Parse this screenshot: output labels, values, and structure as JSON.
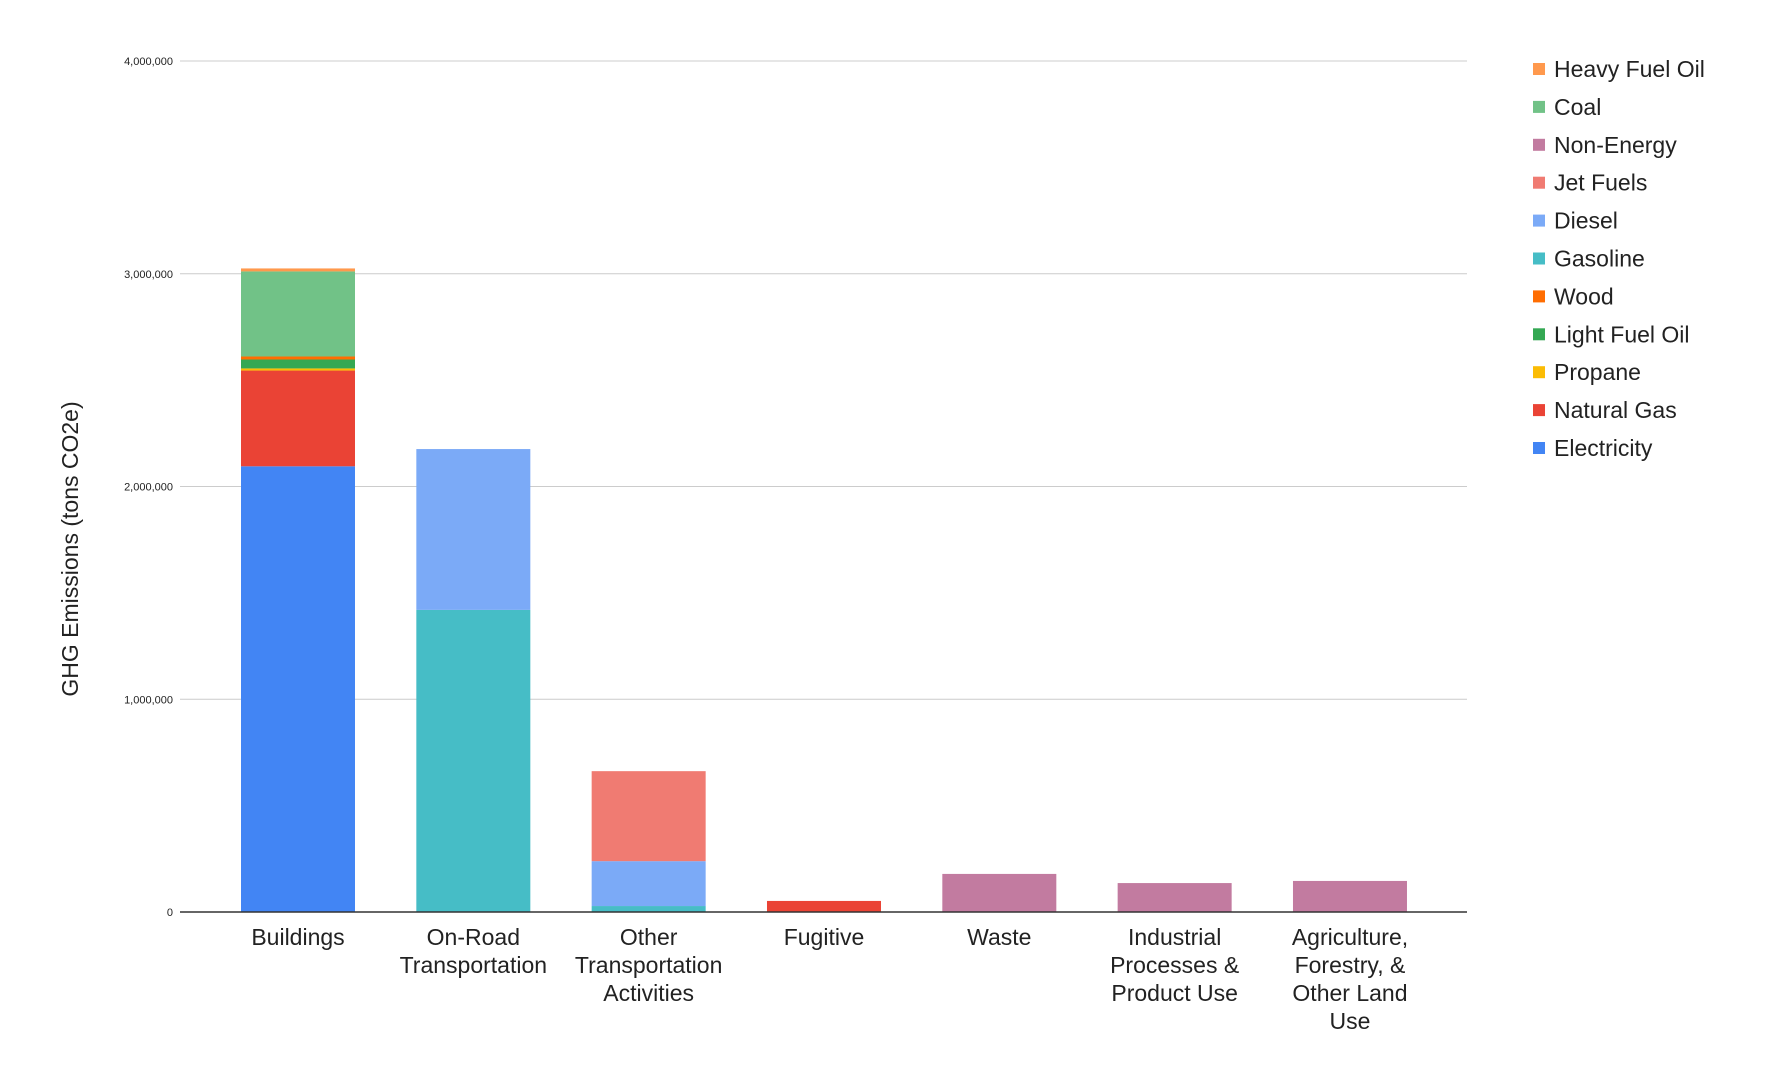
{
  "chart_data": {
    "type": "bar",
    "stacked": true,
    "title": "",
    "xlabel": "",
    "ylabel": "GHG Emissions (tons CO2e)",
    "ylim": [
      0,
      4000000
    ],
    "yticks": [
      0,
      1000000,
      2000000,
      3000000,
      4000000
    ],
    "ytick_labels": [
      "0",
      "1,000,000",
      "2,000,000",
      "3,000,000",
      "4,000,000"
    ],
    "grid": true,
    "legend_position": "right",
    "categories": [
      [
        "Buildings"
      ],
      [
        "On-Road",
        "Transportation"
      ],
      [
        "Other",
        "Transportation",
        "Activities"
      ],
      [
        "Fugitive"
      ],
      [
        "Waste"
      ],
      [
        "Industrial",
        "Processes &",
        "Product Use"
      ],
      [
        "Agriculture,",
        "Forestry, &",
        "Other Land",
        "Use"
      ]
    ],
    "series": [
      {
        "name": "Electricity",
        "color": "#4285f4",
        "values": [
          2095000,
          0,
          0,
          0,
          0,
          0,
          0
        ]
      },
      {
        "name": "Natural Gas",
        "color": "#ea4335",
        "values": [
          450000,
          0,
          0,
          52000,
          0,
          0,
          0
        ]
      },
      {
        "name": "Propane",
        "color": "#fbbc04",
        "values": [
          10000,
          0,
          0,
          0,
          0,
          0,
          0
        ]
      },
      {
        "name": "Light Fuel Oil",
        "color": "#34a853",
        "values": [
          42000,
          0,
          0,
          0,
          0,
          0,
          0
        ]
      },
      {
        "name": "Wood",
        "color": "#ff6d01",
        "values": [
          14000,
          0,
          0,
          0,
          0,
          0,
          0
        ]
      },
      {
        "name": "Gasoline",
        "color": "#46bdc6",
        "values": [
          0,
          1420000,
          28000,
          0,
          0,
          0,
          0
        ]
      },
      {
        "name": "Diesel",
        "color": "#7baaf7",
        "values": [
          0,
          756000,
          211000,
          0,
          0,
          0,
          0
        ]
      },
      {
        "name": "Jet Fuels",
        "color": "#f07b72",
        "values": [
          0,
          0,
          423000,
          0,
          0,
          0,
          0
        ]
      },
      {
        "name": "Non-Energy",
        "color": "#c27ba0",
        "values": [
          0,
          0,
          0,
          0,
          179000,
          136000,
          146000
        ]
      },
      {
        "name": "Coal",
        "color": "#71c287",
        "values": [
          400000,
          0,
          0,
          0,
          0,
          0,
          0
        ]
      },
      {
        "name": "Heavy Fuel Oil",
        "color": "#ff994d",
        "values": [
          14000,
          0,
          0,
          0,
          0,
          0,
          0
        ]
      }
    ],
    "legend_order": [
      "Heavy Fuel Oil",
      "Coal",
      "Non-Energy",
      "Jet Fuels",
      "Diesel",
      "Gasoline",
      "Wood",
      "Light Fuel Oil",
      "Propane",
      "Natural Gas",
      "Electricity"
    ]
  }
}
